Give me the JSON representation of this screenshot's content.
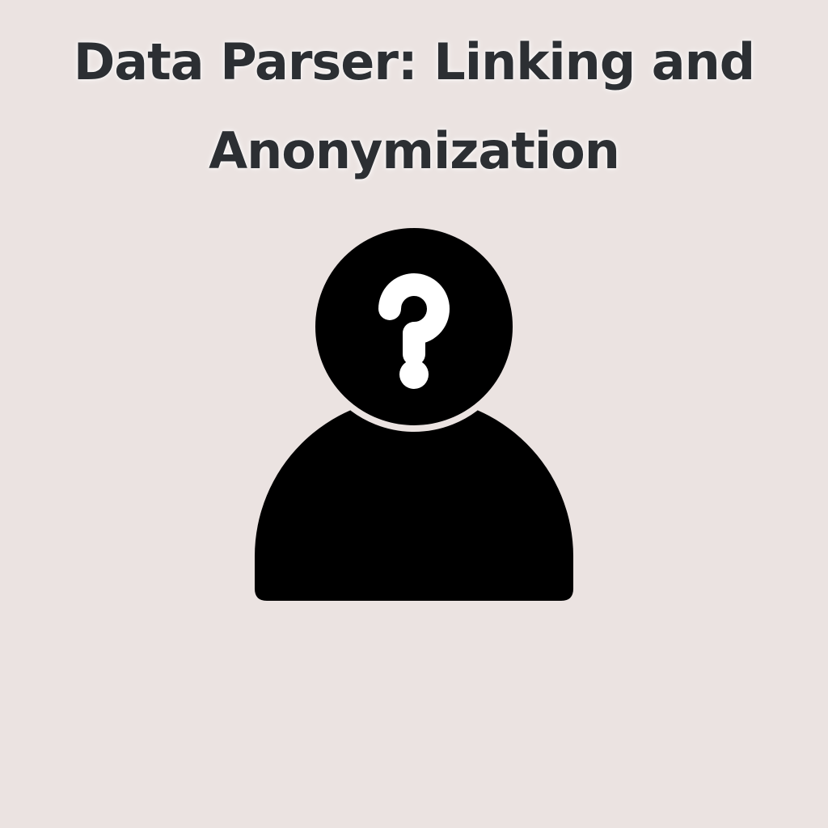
{
  "page": {
    "background_color": "#ebe3e1"
  },
  "header": {
    "title_line_1": "Data Parser: Linking and",
    "title_line_2": "Anonymization",
    "title_color": "#2c2f33"
  },
  "illustration": {
    "icon": "anonymous-user-question-icon",
    "figure_color": "#000000",
    "mark_color": "#ffffff"
  }
}
